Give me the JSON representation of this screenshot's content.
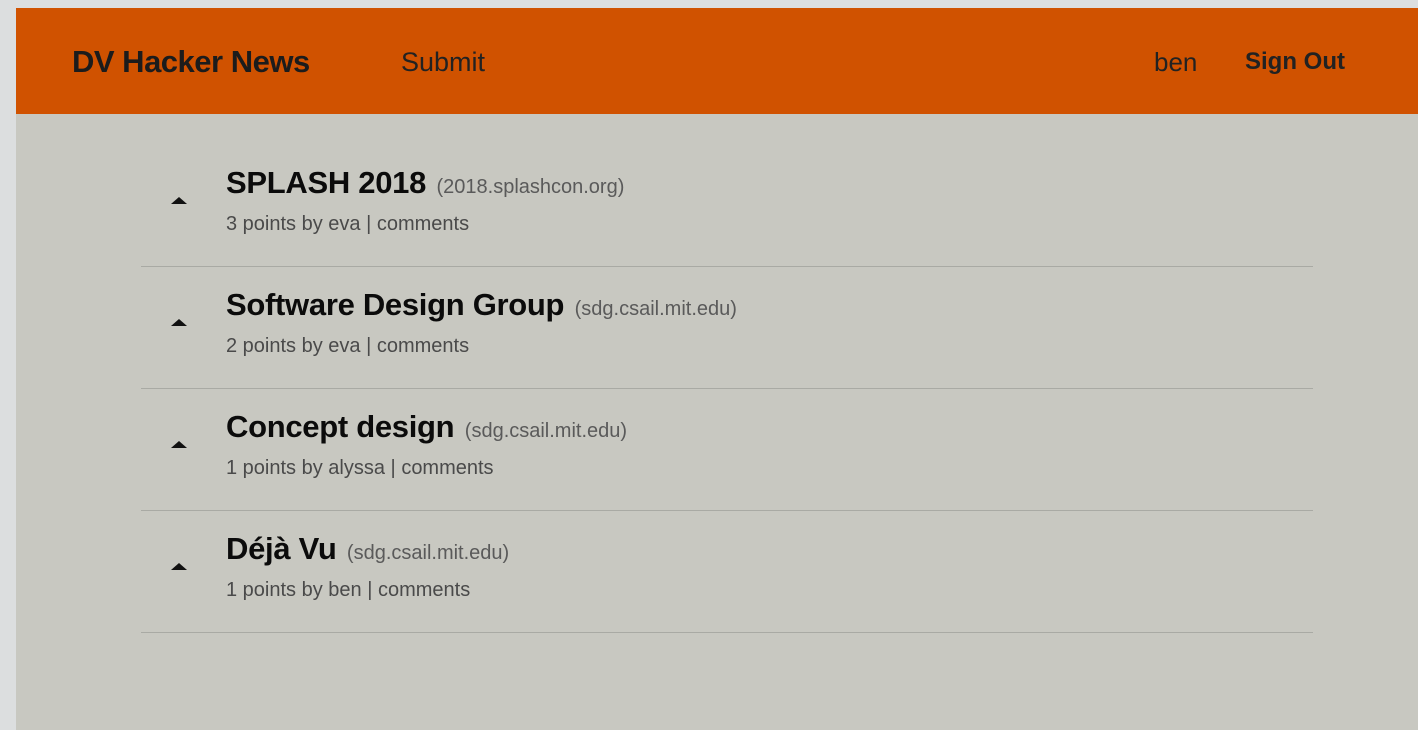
{
  "navbar": {
    "brand": "DV Hacker News",
    "submit_label": "Submit",
    "username": "ben",
    "signout_label": "Sign Out",
    "background_color": "#d05200"
  },
  "stories": [
    {
      "title": "SPLASH 2018",
      "domain": "(2018.splashcon.org)",
      "points": "3",
      "points_suffix": " points by ",
      "author": "eva",
      "separator": " | ",
      "comments_label": "comments",
      "upvote_icon": "upvote-triangle-icon"
    },
    {
      "title": "Software Design Group",
      "domain": "(sdg.csail.mit.edu)",
      "points": "2",
      "points_suffix": " points by ",
      "author": "eva",
      "separator": " | ",
      "comments_label": "comments",
      "upvote_icon": "upvote-triangle-icon"
    },
    {
      "title": "Concept design",
      "domain": "(sdg.csail.mit.edu)",
      "points": "1",
      "points_suffix": " points by ",
      "author": "alyssa",
      "separator": " | ",
      "comments_label": "comments",
      "upvote_icon": "upvote-triangle-icon"
    },
    {
      "title": "Déjà Vu",
      "domain": "(sdg.csail.mit.edu)",
      "points": "1",
      "points_suffix": " points by ",
      "author": "ben",
      "separator": " | ",
      "comments_label": "comments",
      "upvote_icon": "upvote-triangle-icon"
    }
  ],
  "page_background": "#c8c8c1"
}
